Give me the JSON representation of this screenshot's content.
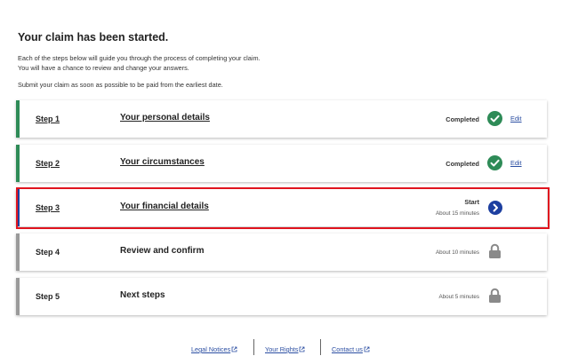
{
  "page": {
    "title": "Your claim has been started.",
    "intro_line1": "Each of the steps below will guide you through the process of completing your claim.",
    "intro_line2": "You will have a chance to review and change your answers.",
    "intro_line3": "Submit your claim as soon as possible to be paid from the earliest date."
  },
  "steps": [
    {
      "number": "Step 1",
      "title": "Your personal details",
      "status": "Completed",
      "action": "Edit",
      "state": "completed",
      "bar_color": "#2e8b57",
      "icon": "check-circle-icon"
    },
    {
      "number": "Step 2",
      "title": "Your circumstances",
      "status": "Completed",
      "action": "Edit",
      "state": "completed",
      "bar_color": "#2e8b57",
      "icon": "check-circle-icon"
    },
    {
      "number": "Step 3",
      "title": "Your financial details",
      "status": "Start",
      "duration": "About 15 minutes",
      "state": "current",
      "bar_color": "#1d3fa0",
      "icon": "chevron-right-circle-icon"
    },
    {
      "number": "Step 4",
      "title": "Review and confirm",
      "duration": "About 10 minutes",
      "state": "locked",
      "bar_color": "#9a9a9a",
      "icon": "lock-icon"
    },
    {
      "number": "Step 5",
      "title": "Next steps",
      "duration": "About 5 minutes",
      "state": "locked",
      "bar_color": "#9a9a9a",
      "icon": "lock-icon"
    }
  ],
  "footer": {
    "links": [
      {
        "label": "Legal Notices",
        "icon": "external-link-icon"
      },
      {
        "label": "Your Rights",
        "icon": "external-link-icon"
      },
      {
        "label": "Contact us",
        "icon": "external-link-icon"
      }
    ]
  },
  "colors": {
    "completed": "#2e8b57",
    "current": "#1d3fa0",
    "locked": "#9a9a9a",
    "highlight": "#e0141e",
    "link": "#2b4ea2"
  }
}
